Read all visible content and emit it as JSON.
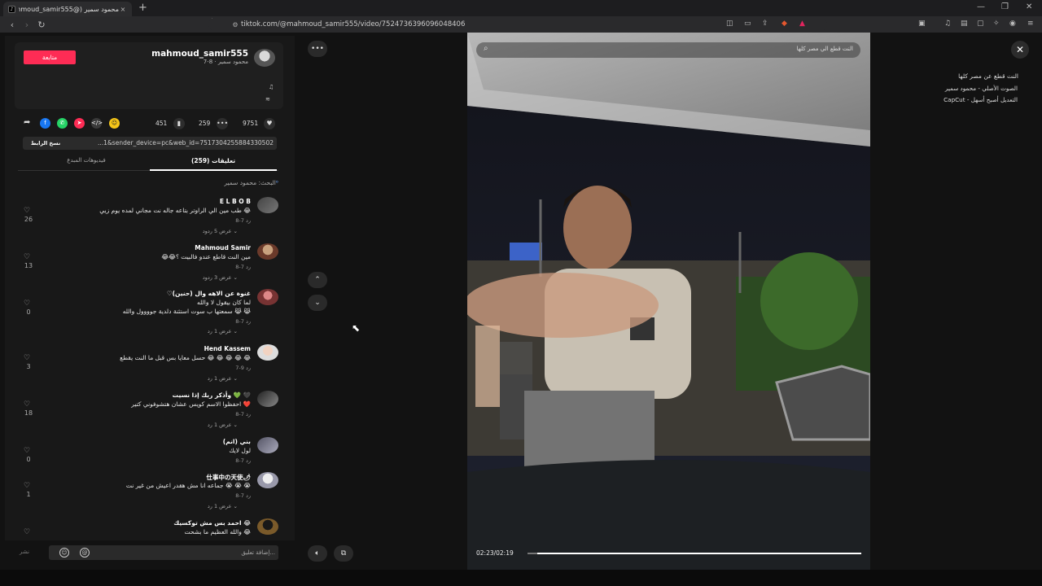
{
  "browser": {
    "tab_title": "محمود سمير (@mahmoud_samir555)",
    "tab_close": "×",
    "new_tab": "+",
    "url": "tiktok.com/@mahmoud_samir555/video/7524736396096048406"
  },
  "video_info": {
    "follow_label": "متابعة",
    "username": "mahmoud_samir555",
    "subline": "محمود سمير · 8-7",
    "caption": "النت قطع عن مصر كلها",
    "sound": "الصوت الأصلي - محمود سمير",
    "capcut": "CapCut - التعديل أصبح أسهل"
  },
  "actions": {
    "likes": "9751",
    "comments": "259",
    "saves": "451"
  },
  "link": {
    "copy_label": "نسخ الرابط",
    "text": "...1&sender_device=pc&web_id=7517304255884330502"
  },
  "tabs": {
    "comments": "(259) تعليقات",
    "creator_videos": "فيديوهات المبدع"
  },
  "search_label": "البحث: محمود سمير",
  "comments": [
    {
      "name": "E L B O B",
      "lines": [
        "طب مين الي الراوتر بتاعه جاله نت مجاني لمده يوم زيي 😂"
      ],
      "meta": "8-7   رد",
      "replies": "عرض 5 ردود ⌄",
      "likes": "26"
    },
    {
      "name": "Mahmoud Samir",
      "lines": [
        "😂😂مين النت قاطع عندو فالبيت ؟"
      ],
      "meta": "8-7   رد",
      "replies": "عرض 3 ردود ⌄",
      "likes": "13"
    },
    {
      "name": "♡(حنين) غنوة عن الاهه وال",
      "lines": [
        "لما كان بيقول لا والله",
        "سمعتها ب سوت استئنة دلدية جوووول والله 😹 😹"
      ],
      "meta": "8-7   رد",
      "replies": "عرض 1 رد ⌄",
      "likes": "0"
    },
    {
      "name": "Hend Kassem",
      "lines": [
        "حسل معايا بس قبل ما النت يقطع 😂 😂 😂 😂 😂"
      ],
      "meta": "7-9   رد",
      "replies": "عرض 1 رد ⌄",
      "likes": "3"
    },
    {
      "name": "وأذكر ربك إذا نسيت 💚 🖤",
      "lines": [
        "احفظوا الاسم كويس عشان هتشوفوني كتير ❤️"
      ],
      "meta": "8-7   رد",
      "replies": "عرض 1 رد ⌄",
      "likes": "18"
    },
    {
      "name": "بني (انم)",
      "lines": [
        "لول لايك"
      ],
      "meta": "8-7   رد",
      "replies": "",
      "likes": "0"
    },
    {
      "name": "仕事中の天使🌶",
      "lines": [
        "جماعه انا مش هقدر اعيش من غير نت 😭 😭 😭"
      ],
      "meta": "8-7   رد",
      "replies": "عرض 1 رد ⌄",
      "likes": "1"
    },
    {
      "name": "احمد بس مش توكسيك 😂",
      "lines": [
        "والله العظيم ما بشحت 😂"
      ],
      "meta": "",
      "replies": "",
      "likes": ""
    }
  ],
  "comment_input": {
    "placeholder": "إضافة تعليق...",
    "post_label": "نشر"
  },
  "player": {
    "search_text": "النت قطع الي مصر كلها",
    "time": "02:23/02:19",
    "progress": 0.97
  },
  "icons": {
    "more": "more-icon",
    "up": "chevron-up-icon",
    "down": "chevron-down-icon",
    "volume": "volume-icon",
    "pip": "picture-in-picture-icon",
    "close": "close-icon"
  },
  "colors": {
    "follow": "#fe2c55",
    "accent_blue": "#6fa8ff"
  }
}
